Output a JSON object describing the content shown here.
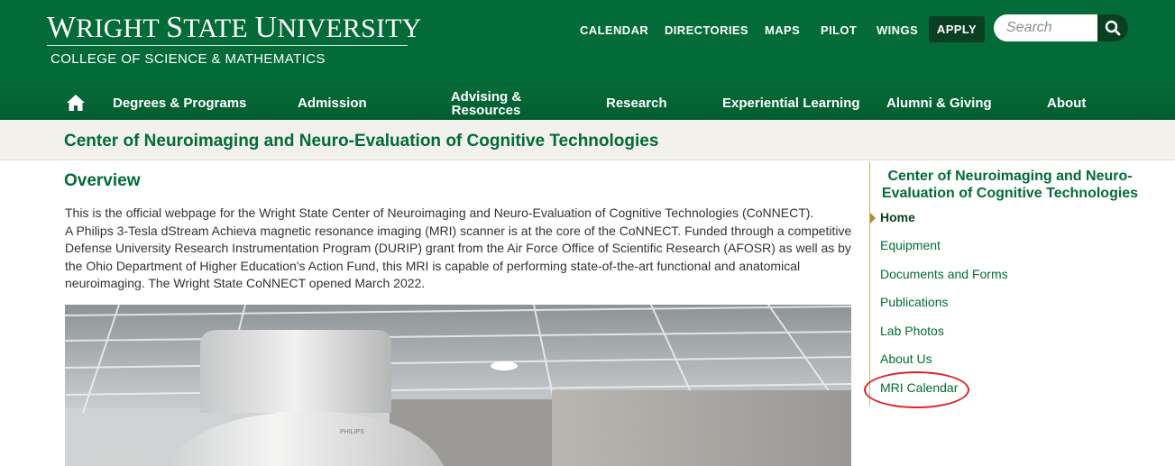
{
  "header": {
    "logo_word1_initial": "W",
    "logo_word1": "RIGHT",
    "logo_word2_initial": "S",
    "logo_word2": "TATE",
    "logo_word3_initial": "U",
    "logo_word3": "NIVERSITY",
    "college": "COLLEGE OF SCIENCE & MATHEMATICS",
    "utility_links": [
      "CALENDAR",
      "DIRECTORIES",
      "MAPS",
      "PILOT",
      "WINGS"
    ],
    "apply_label": "APPLY",
    "search_placeholder": "Search"
  },
  "nav": {
    "items": [
      "Degrees & Programs",
      "Admission",
      "Advising &",
      "Resources",
      "Research",
      "Experiential Learning",
      "Alumni & Giving",
      "About"
    ]
  },
  "band": {
    "title": "Center of Neuroimaging and Neuro-Evaluation of Cognitive Technologies"
  },
  "main": {
    "heading": "Overview",
    "para1": "This is the official webpage for the Wright State Center of Neuroimaging and Neuro-Evaluation of Cognitive Technologies (CoNNECT).",
    "para2": "A Philips 3-Tesla dStream Achieva magnetic resonance imaging (MRI) scanner is at the core of the CoNNECT. Funded through a competitive Defense University Research Instrumentation Program (DURIP) grant from the Air Force Office of Scientific Research (AFOSR) as well as by the Ohio Department of Higher Education's Action Fund, this MRI is capable of performing state-of-the-art functional and anatomical neuroimaging. The Wright State CoNNECT opened March 2022.",
    "photo_brand": "PHILIPS"
  },
  "sidebar": {
    "title": "Center of Neuroimaging and Neuro-Evaluation of Cognitive Technologies",
    "links": [
      "Home",
      "Equipment",
      "Documents and Forms",
      "Publications",
      "Lab Photos",
      "About Us",
      "MRI Calendar"
    ],
    "active": "Home"
  },
  "colors": {
    "brand_green": "#036b38",
    "dark_green": "#0b3f22",
    "gold_accent": "#b58a2e",
    "annotation_red": "#e0202a"
  }
}
